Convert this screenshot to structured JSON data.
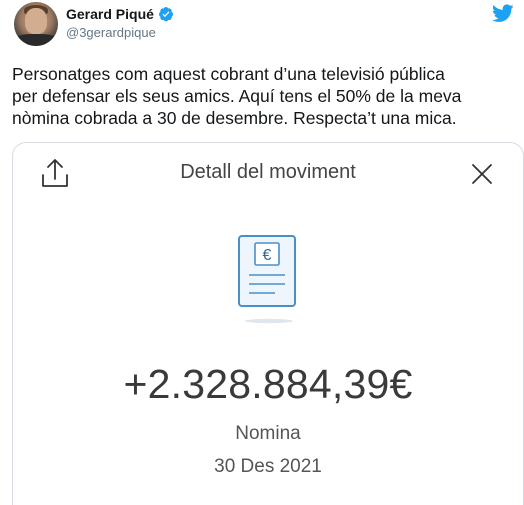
{
  "author": {
    "display_name": "Gerard Piqué",
    "handle": "@3gerardpique"
  },
  "icons": {
    "avatar": "profile-photo",
    "verified": "verified-badge-icon",
    "platform": "twitter-bird-icon"
  },
  "colors": {
    "twitter_blue": "#1da1f2",
    "text_primary": "#14171a",
    "text_secondary": "#657786",
    "card_border": "#d6dce1",
    "doc_accent": "#4a90c8"
  },
  "tweet": {
    "lines": [
      "Personatges com aquest cobrant d’una televisió pública",
      "per defensar els seus amics. Aquí tens el 50% de la meva",
      "nòmina cobrada a 30 de desembre. Respecta’t una mica."
    ]
  },
  "card": {
    "title": "Detall del moviment",
    "amount": "+2.328.884,39€",
    "concept": "Nomina",
    "date": "30 Des 2021",
    "doc_symbol": "€"
  }
}
